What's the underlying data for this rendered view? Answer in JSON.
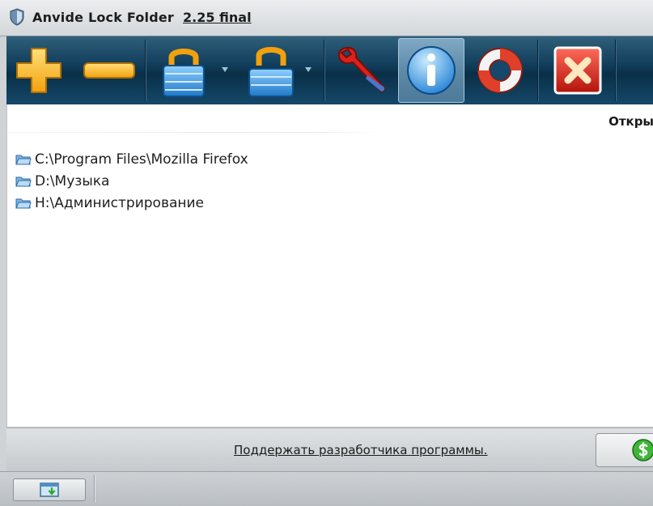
{
  "window": {
    "app_name": "Anvide Lock Folder",
    "version": "2.25 final"
  },
  "toolbar": {
    "buttons": [
      {
        "name": "add-folder",
        "icon": "plus-icon"
      },
      {
        "name": "remove-folder",
        "icon": "minus-icon"
      },
      {
        "name": "lock-folder",
        "icon": "lock-closed-icon"
      },
      {
        "name": "unlock-folder",
        "icon": "lock-open-icon"
      },
      {
        "name": "settings",
        "icon": "wrench-icon"
      },
      {
        "name": "about",
        "icon": "info-icon"
      },
      {
        "name": "help",
        "icon": "lifebuoy-icon"
      },
      {
        "name": "exit",
        "icon": "close-icon"
      }
    ],
    "accent_colors": {
      "plus": "#f5b21f",
      "lock": "#3a9ee0",
      "close": "#d8231c",
      "lifebuoy": "#e0402a"
    }
  },
  "content": {
    "column_header": "Откры",
    "folders": [
      {
        "path": "C:\\Program Files\\Mozilla Firefox"
      },
      {
        "path": "D:\\Музыка"
      },
      {
        "path": "H:\\Администрирование"
      }
    ]
  },
  "footer": {
    "support_link": "Поддержать разработчика программы."
  }
}
